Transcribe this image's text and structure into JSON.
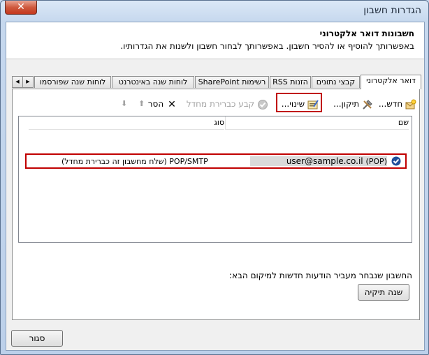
{
  "window": {
    "title": "הגדרות חשבון",
    "close_glyph": "✕"
  },
  "header": {
    "title": "חשבונות דואר אלקטרוני",
    "description": "באפשרותך להוסיף או להסיר חשבון. באפשרותך לבחור חשבון ולשנות את הגדרותיו."
  },
  "tabs": [
    {
      "label": "דואר אלקטרוני",
      "active": true
    },
    {
      "label": "קבצי נתונים"
    },
    {
      "label": "הזנות RSS"
    },
    {
      "label": "רשימות SharePoint"
    },
    {
      "label": "לוחות שנה באינטרנט"
    },
    {
      "label": "לוחות שנה שפורסמו"
    }
  ],
  "toolbar": {
    "new_label": "חדש...",
    "repair_label": "תיקון...",
    "change_label": "שינוי...",
    "set_default_label": "קבע כברירת מחדל",
    "remove_label": "הסר"
  },
  "list": {
    "col_name": "שם",
    "col_type": "סוג",
    "rows": [
      {
        "name": "user@sample.co.il",
        "protocol": "(POP)",
        "type": "POP/SMTP (שלח מחשבון זה כברירת מחדל)"
      }
    ]
  },
  "footer": {
    "delivery_text": "החשבון שנבחר מעביר הודעות חדשות למיקום הבא:",
    "change_folder_label": "שנה תיקיה"
  },
  "close_button_label": "סגור",
  "colors": {
    "highlight": "#c00000",
    "accent": "#1f4e9a"
  }
}
